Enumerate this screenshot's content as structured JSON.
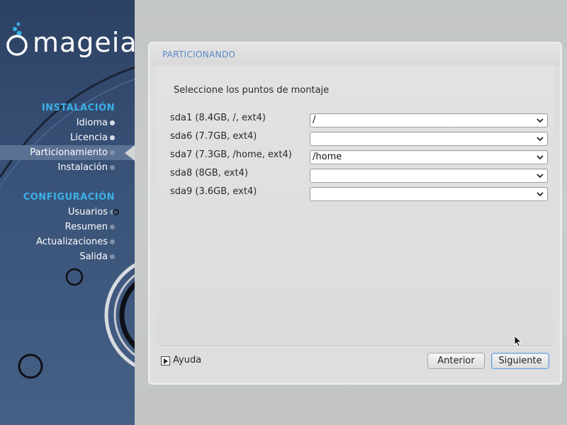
{
  "brand": {
    "name": "mageia"
  },
  "sidebar": {
    "sections": [
      {
        "title": "INSTALACIÓN",
        "items": [
          {
            "label": "Idioma",
            "state": "done"
          },
          {
            "label": "Licencia",
            "state": "done"
          },
          {
            "label": "Particionamiento",
            "state": "current"
          },
          {
            "label": "Instalación",
            "state": "pending"
          }
        ]
      },
      {
        "title": "CONFIGURACIÓN",
        "items": [
          {
            "label": "Usuarios",
            "state": "pending"
          },
          {
            "label": "Resumen",
            "state": "pending"
          },
          {
            "label": "Actualizaciones",
            "state": "pending"
          },
          {
            "label": "Salida",
            "state": "pending"
          }
        ]
      }
    ]
  },
  "panel": {
    "title": "PARTICIONANDO",
    "subtitle": "Seleccione los puntos de montaje",
    "mount_points": [
      {
        "partition": "sda1 (8.4GB, /, ext4)",
        "value": "/"
      },
      {
        "partition": "sda6 (7.7GB, ext4)",
        "value": ""
      },
      {
        "partition": "sda7 (7.3GB, /home, ext4)",
        "value": "/home"
      },
      {
        "partition": "sda8 (8GB, ext4)",
        "value": ""
      },
      {
        "partition": "sda9 (3.6GB, ext4)",
        "value": ""
      }
    ]
  },
  "footer": {
    "help_label": "Ayuda",
    "back_label": "Anterior",
    "next_label": "Siguiente"
  },
  "colors": {
    "sidebar_bg": "#3a5379",
    "section_title": "#3ab0e6",
    "panel_title": "#5a86c9",
    "active_item_bg": "#5c7294"
  }
}
